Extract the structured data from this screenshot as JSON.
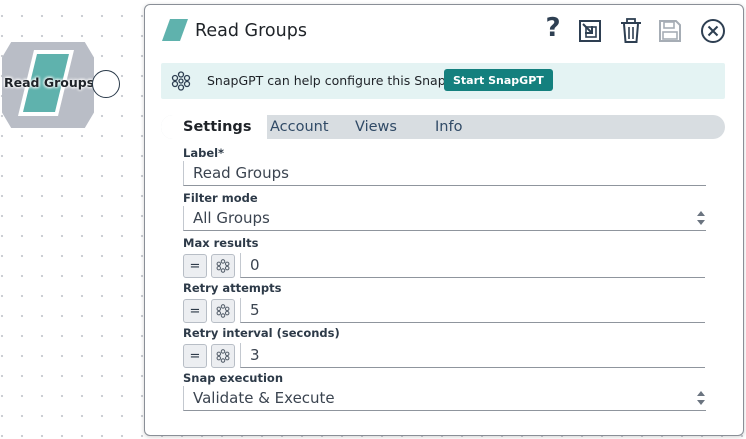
{
  "canvas": {
    "node": {
      "label": "Read Groups",
      "color": "#5fb2ad"
    }
  },
  "dialog": {
    "title": "Read Groups",
    "toolbar": {
      "help_glyph": "?",
      "icons": [
        "help-icon",
        "export-icon",
        "trash-icon",
        "save-icon",
        "close-icon"
      ]
    },
    "banner": {
      "text": "SnapGPT can help configure this Snap.",
      "button_label": "Start SnapGPT"
    },
    "tabs": [
      {
        "label": "Settings",
        "active": true
      },
      {
        "label": "Account"
      },
      {
        "label": "Views"
      },
      {
        "label": "Info"
      }
    ],
    "fields": {
      "label": {
        "label": "Label*",
        "value": "Read Groups"
      },
      "filter_mode": {
        "label": "Filter mode",
        "value": "All Groups"
      },
      "max_results": {
        "label": "Max results",
        "value": "0"
      },
      "retry_attempts": {
        "label": "Retry attempts",
        "value": "5"
      },
      "retry_interval": {
        "label": "Retry interval (seconds)",
        "value": "3"
      },
      "snap_execution": {
        "label": "Snap execution",
        "value": "Validate & Execute"
      }
    },
    "expr_toggle_glyph": "="
  },
  "colors": {
    "accent": "#14807e",
    "banner_bg": "#e4f3f3",
    "tab_bar": "#d8dde1",
    "icon": "#2e3f52"
  }
}
